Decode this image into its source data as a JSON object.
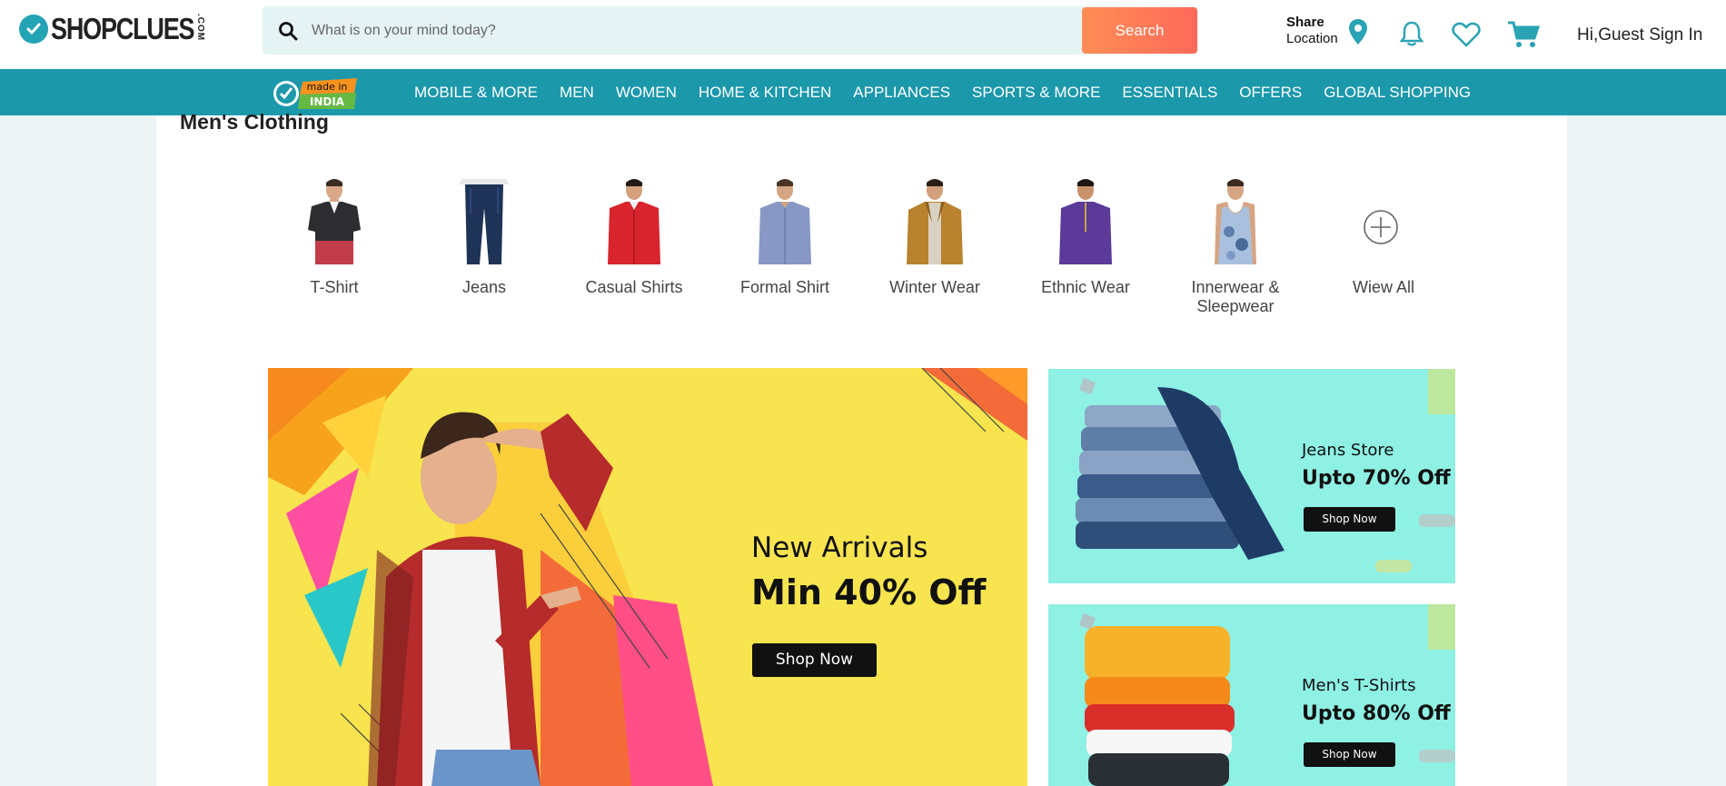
{
  "header": {
    "logo_text": "SHOPCLUES",
    "logo_suffix": ".COM",
    "search_placeholder": "What is on your mind today?",
    "search_button": "Search",
    "share_title": "Share",
    "share_subtitle": "Location",
    "signin": "Hi,Guest Sign In"
  },
  "nav": {
    "badge_top": "made in",
    "badge_bottom": "INDIA",
    "items": [
      "MOBILE & MORE",
      "MEN",
      "WOMEN",
      "HOME & KITCHEN",
      "APPLIANCES",
      "SPORTS & MORE",
      "ESSENTIALS",
      "OFFERS",
      "GLOBAL SHOPPING"
    ]
  },
  "section": {
    "title": "Men's Clothing",
    "categories": [
      {
        "label": "T-Shirt"
      },
      {
        "label": "Jeans"
      },
      {
        "label": "Casual Shirts"
      },
      {
        "label": "Formal Shirt"
      },
      {
        "label": "Winter Wear"
      },
      {
        "label": "Ethnic Wear"
      },
      {
        "label": "Innerwear & Sleepwear"
      },
      {
        "label": "Wiew All"
      }
    ]
  },
  "banners": {
    "main": {
      "title": "New Arrivals",
      "offer": "Min 40% Off",
      "button": "Shop Now"
    },
    "jeans": {
      "title": "Jeans Store",
      "offer": "Upto 70% Off",
      "button": "Shop Now"
    },
    "tshirts": {
      "title": "Men's T-Shirts",
      "offer": "Upto 80% Off",
      "button": "Shop Now"
    }
  },
  "colors": {
    "brand_teal": "#1c98ab",
    "search_orange": "#ff7a58",
    "banner_yellow": "#f7e44f",
    "banner_mint": "#8ff0e4"
  }
}
